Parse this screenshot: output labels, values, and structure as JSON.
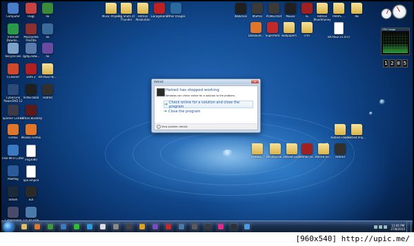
{
  "dialog": {
    "window_title": "Hatred",
    "heading": "Hatred has stopped working",
    "description": "Windows can check online for a solution to the problem.",
    "option_online": "Check online for a solution and close the program",
    "option_close": "Close the program",
    "details": "View problem details"
  },
  "desktop_icons": [
    {
      "label": "Computer",
      "kind": "app",
      "color": "#4a7ec9",
      "icon": "computer-icon"
    },
    {
      "label": "Flags",
      "kind": "app",
      "color": "#c94242",
      "icon": "flag-icon"
    },
    {
      "label": "ISI",
      "kind": "app",
      "color": "#3a8a3a",
      "icon": "app-icon"
    },
    {
      "label": "Internet Downlo...",
      "kind": "app",
      "color": "#2a9a4a",
      "icon": "download-icon"
    },
    {
      "label": "Mozzarella FileZilla",
      "kind": "app",
      "color": "#8a3030",
      "icon": "app-icon"
    },
    {
      "label": "ISI",
      "kind": "app",
      "color": "#3a6a9a",
      "icon": "app-icon"
    },
    {
      "label": "Recycle Bin",
      "kind": "app",
      "color": "#7fa2c8",
      "icon": "recycle-bin-icon"
    },
    {
      "label": "zgdlji2lidw...",
      "kind": "app",
      "color": "#5a7aaa",
      "icon": "app-icon"
    },
    {
      "label": "ISI",
      "kind": "app",
      "color": "#6a4aa0",
      "icon": "app-icon"
    },
    {
      "label": "CCleaner",
      "kind": "app",
      "color": "#d04a2a",
      "icon": "ccleaner-icon"
    },
    {
      "label": "Defa 2",
      "kind": "app",
      "color": "#b02020",
      "icon": "app-icon"
    },
    {
      "label": "HATRED RE...",
      "kind": "folder",
      "color": "#e0c060",
      "icon": "folder-icon"
    },
    {
      "label": "CyberLink PowerDVD 12",
      "kind": "app",
      "color": "#2a4a7a",
      "icon": "dvd-icon"
    },
    {
      "label": "ViVKo tabla",
      "kind": "app",
      "color": "#202020",
      "icon": "app-icon"
    },
    {
      "label": "Hatred",
      "kind": "app",
      "color": "#303030",
      "icon": "game-icon"
    },
    {
      "label": "Splinter Cell EE",
      "kind": "app",
      "color": "#3a3a4a",
      "icon": "game-icon"
    },
    {
      "label": "Hitman Blackley",
      "kind": "app",
      "color": "#5a1a1a",
      "icon": "game-icon"
    },
    {
      "label": "Firefox",
      "kind": "app",
      "color": "#e0762a",
      "icon": "firefox-icon"
    },
    {
      "label": "Mozilla Firefox",
      "kind": "app",
      "color": "#e0762a",
      "icon": "firefox-icon"
    },
    {
      "label": "Free MP3 Cutter",
      "kind": "app",
      "color": "#3a7ac0",
      "icon": "audio-icon"
    },
    {
      "label": "img3080",
      "kind": "doc",
      "color": "#ffffff",
      "icon": "document-icon"
    },
    {
      "label": "MalMag",
      "kind": "app",
      "color": "#2a5a9a",
      "icon": "app-icon"
    },
    {
      "label": "ape.empire",
      "kind": "doc",
      "color": "#ffffff",
      "icon": "document-icon"
    },
    {
      "label": "Steam",
      "kind": "app",
      "color": "#1a2a3a",
      "icon": "steam-icon"
    },
    {
      "label": "EDI",
      "kind": "app",
      "color": "#2a2a2a",
      "icon": "app-icon"
    },
    {
      "label": "Cyberganoo",
      "kind": "app",
      "color": "#4a4a6a",
      "icon": "app-icon"
    },
    {
      "label": "CD 3D Free Project 3.14",
      "kind": "app",
      "color": "#4a7aaa",
      "icon": "app-icon"
    },
    {
      "label": "Music Project",
      "kind": "folder",
      "color": "#e0c060",
      "icon": "folder-icon"
    },
    {
      "label": "Big Shots of Thunder",
      "kind": "folder",
      "color": "#e0c060",
      "icon": "folder-icon"
    },
    {
      "label": "Hitman Absolution",
      "kind": "folder",
      "color": "#e0c060",
      "icon": "folder-icon"
    },
    {
      "label": "Garageband",
      "kind": "app",
      "color": "#c02020",
      "icon": "app-icon"
    },
    {
      "label": "Other Images",
      "kind": "app",
      "color": "#2a6aa0",
      "icon": "app-icon"
    },
    {
      "label": "Walkman",
      "kind": "app",
      "color": "#202020",
      "icon": "walkman-icon"
    },
    {
      "label": "MSPVis",
      "kind": "app",
      "color": "#3a3a3a",
      "icon": "app-icon"
    },
    {
      "label": "POWErshot",
      "kind": "app",
      "color": "#3a3a3a",
      "icon": "app-icon"
    },
    {
      "label": "Mouse",
      "kind": "app",
      "color": "#202020",
      "icon": "cursor-icon"
    },
    {
      "label": "IE",
      "kind": "app",
      "color": "#a02020",
      "icon": "app-icon"
    },
    {
      "label": "Hitman Bloodmoney",
      "kind": "folder",
      "color": "#e0c060",
      "icon": "folder-icon"
    },
    {
      "label": "PRAPS ...",
      "kind": "folder",
      "color": "#e0c060",
      "icon": "folder-icon"
    },
    {
      "label": "AB",
      "kind": "folder",
      "color": "#e0c060",
      "icon": "folder-icon"
    },
    {
      "label": "DasBaudi...",
      "kind": "app",
      "color": "#e0762a",
      "icon": "app-icon"
    },
    {
      "label": "Superhero",
      "kind": "app",
      "color": "#c02a2a",
      "icon": "app-icon"
    },
    {
      "label": "wallpapers",
      "kind": "folder",
      "color": "#e0c060",
      "icon": "folder-icon"
    },
    {
      "label": "ChFr",
      "kind": "folder",
      "color": "#e0c060",
      "icon": "folder-icon"
    },
    {
      "label": "HATRED 25.0.07",
      "kind": "doc",
      "color": "#ffffff",
      "icon": "document-icon"
    },
    {
      "label": "Hatred Folder",
      "kind": "folder",
      "color": "#e0c060",
      "icon": "folder-icon"
    },
    {
      "label": "Hatred Proj...",
      "kind": "folder",
      "color": "#e0c060",
      "icon": "folder-icon"
    },
    {
      "label": "Hatred...",
      "kind": "folder",
      "color": "#e0c060",
      "icon": "folder-icon"
    },
    {
      "label": "HATRED RE...",
      "kind": "folder",
      "color": "#e0c060",
      "icon": "folder-icon"
    },
    {
      "label": "Hatred Logs",
      "kind": "folder",
      "color": "#e0c060",
      "icon": "folder-icon"
    },
    {
      "label": "Hitman Bl...",
      "kind": "app",
      "color": "#a02020",
      "icon": "app-icon"
    },
    {
      "label": "Hatred Scr...",
      "kind": "folder",
      "color": "#e0c060",
      "icon": "folder-icon"
    },
    {
      "label": "Hatred",
      "kind": "app",
      "color": "#303030",
      "icon": "game-icon"
    }
  ],
  "gadget": {
    "cpu_label": "CPU Usage",
    "clock_digits": [
      "1",
      "2",
      "0",
      "5"
    ]
  },
  "taskbar": {
    "apps": [
      {
        "icon": "explorer-icon",
        "color": "#e0c060"
      },
      {
        "icon": "firefox-icon",
        "color": "#e0762a"
      },
      {
        "icon": "chrome-icon",
        "color": "#3a9a3a"
      },
      {
        "icon": "media-player-icon",
        "color": "#3a7ac0"
      },
      {
        "icon": "line-icon",
        "color": "#2ac02a"
      },
      {
        "icon": "skype-icon",
        "color": "#2a9ae0"
      },
      {
        "icon": "thunderbolt-icon",
        "color": "#dddddd"
      },
      {
        "icon": "app-icon",
        "color": "#888888"
      },
      {
        "icon": "app-icon",
        "color": "#444444"
      },
      {
        "icon": "winamp-icon",
        "color": "#e0a020"
      },
      {
        "icon": "visual-studio-icon",
        "color": "#7a4ac0"
      },
      {
        "icon": "app-icon",
        "color": "#c02a2a"
      },
      {
        "icon": "app-icon",
        "color": "#4a7aaa"
      },
      {
        "icon": "app-icon",
        "color": "#5a5a5a"
      },
      {
        "icon": "app-icon",
        "color": "#3a3a3a"
      },
      {
        "icon": "app-icon",
        "color": "#e02a8a"
      },
      {
        "icon": "app-icon",
        "color": "#303030"
      },
      {
        "icon": "app-icon",
        "color": "#4a9ae0"
      }
    ],
    "time": "12:05 PM",
    "date": "27/8/2015"
  },
  "watermark": "[960x540] http://upic.me/"
}
